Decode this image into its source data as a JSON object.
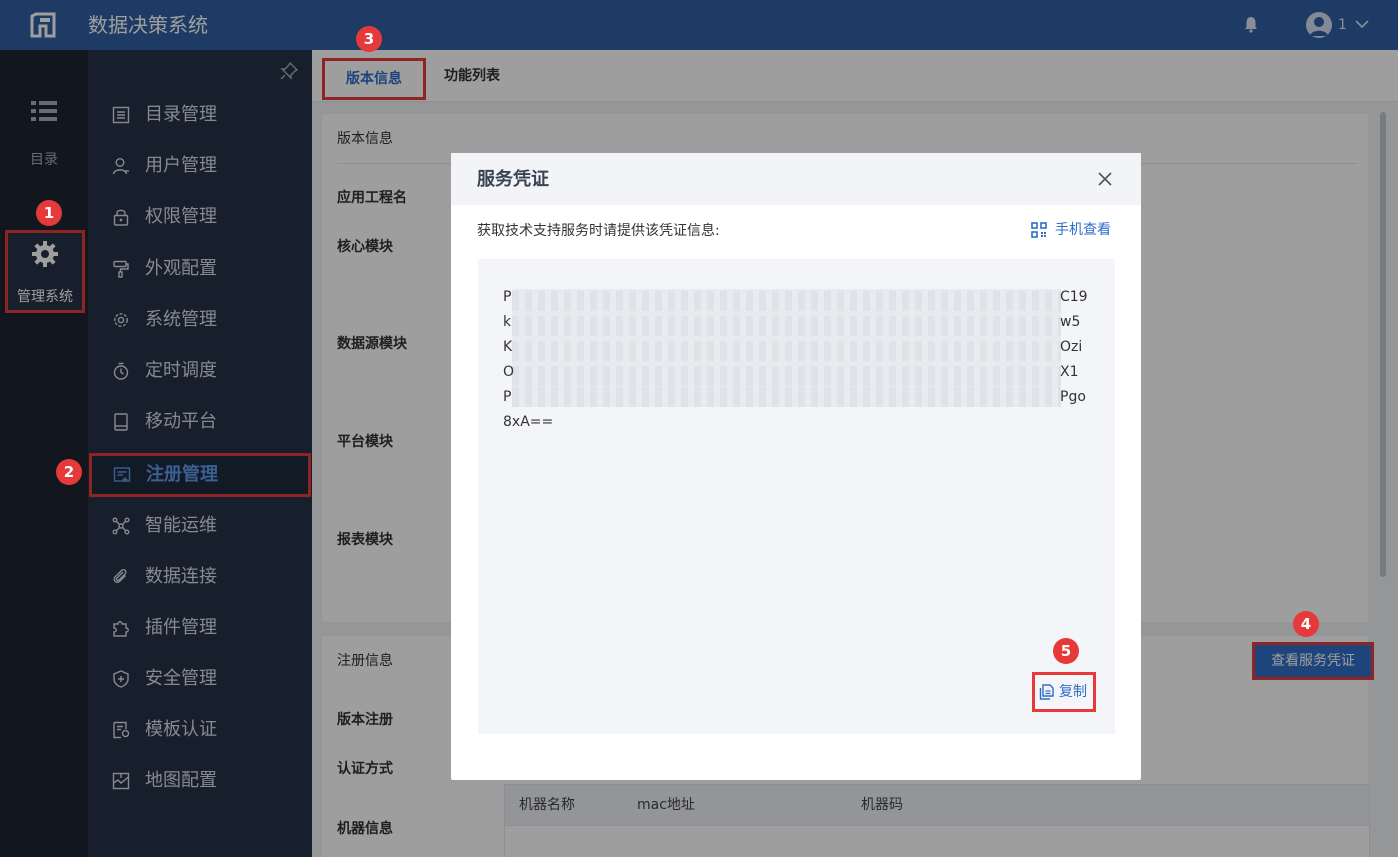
{
  "header": {
    "app_title": "数据决策系统",
    "user_name": "1"
  },
  "rail": {
    "catalog_label": "目录",
    "admin_label": "管理系统"
  },
  "sidebar": {
    "items": [
      {
        "label": "目录管理",
        "icon": "list-icon"
      },
      {
        "label": "用户管理",
        "icon": "user-icon"
      },
      {
        "label": "权限管理",
        "icon": "lock-icon"
      },
      {
        "label": "外观配置",
        "icon": "paint-roller-icon"
      },
      {
        "label": "系统管理",
        "icon": "gear-icon"
      },
      {
        "label": "定时调度",
        "icon": "timer-icon"
      },
      {
        "label": "移动平台",
        "icon": "mobile-icon"
      },
      {
        "label": "注册管理",
        "icon": "register-icon",
        "active": true
      },
      {
        "label": "智能运维",
        "icon": "network-icon"
      },
      {
        "label": "数据连接",
        "icon": "link-icon"
      },
      {
        "label": "插件管理",
        "icon": "puzzle-icon"
      },
      {
        "label": "安全管理",
        "icon": "shield-icon"
      },
      {
        "label": "模板认证",
        "icon": "certificate-icon"
      },
      {
        "label": "地图配置",
        "icon": "map-icon"
      }
    ]
  },
  "tabs": {
    "version": "版本信息",
    "features": "功能列表"
  },
  "version_card": {
    "title": "版本信息",
    "fields": {
      "app_name": "应用工程名",
      "core": "核心模块",
      "datasource": "数据源模块",
      "platform": "平台模块",
      "report": "报表模块"
    }
  },
  "register_card": {
    "title": "注册信息",
    "view_cert_button": "查看服务凭证",
    "fields": {
      "version_reg": "版本注册",
      "auth_method": "认证方式",
      "machine_info": "机器信息"
    },
    "table_headers": [
      "机器名称",
      "mac地址",
      "机器码"
    ]
  },
  "modal": {
    "title": "服务凭证",
    "description": "获取技术支持服务时请提供该凭证信息:",
    "mobile_view": "手机查看",
    "cert_lines": [
      {
        "start": "P",
        "end": "C19"
      },
      {
        "start": "k",
        "end": "w5"
      },
      {
        "start": "K",
        "end": "Ozi"
      },
      {
        "start": "O",
        "end": "X1"
      },
      {
        "start": "P",
        "end": "Pgo"
      }
    ],
    "cert_last_line": "8xA==",
    "copy": "复制"
  },
  "badges": [
    "1",
    "2",
    "3",
    "4",
    "5"
  ],
  "colors": {
    "topbar": "#2f5fa4",
    "sidebar": "#283248",
    "rail": "#1c2433",
    "accent": "#2f6ec7",
    "highlight": "#e63a3a"
  }
}
